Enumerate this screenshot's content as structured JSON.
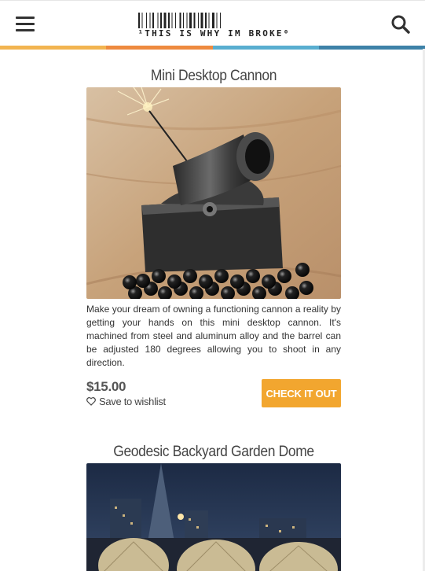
{
  "header": {
    "menu_icon": "hamburger-menu-icon",
    "search_icon": "search-icon",
    "logo_text": "THIS IS WHY IM BROKE",
    "color_stripes": [
      "#f2b450",
      "#ee8a3f",
      "#59aed0",
      "#3e82a8"
    ]
  },
  "products": [
    {
      "title": "Mini Desktop Cannon",
      "description": "Make your dream of owning a functioning cannon a reality by getting your hands on this mini desktop cannon. It's machined from steel and aluminum alloy and the barrel can be adjusted 180 degrees allowing you to shoot in any direction.",
      "price": "$15.00",
      "wishlist_label": "Save to wishlist",
      "cta_label": "CHECK IT OUT"
    },
    {
      "title": "Geodesic Backyard Garden Dome"
    }
  ],
  "colors": {
    "cta": "#f2a62f",
    "text": "#333333"
  }
}
